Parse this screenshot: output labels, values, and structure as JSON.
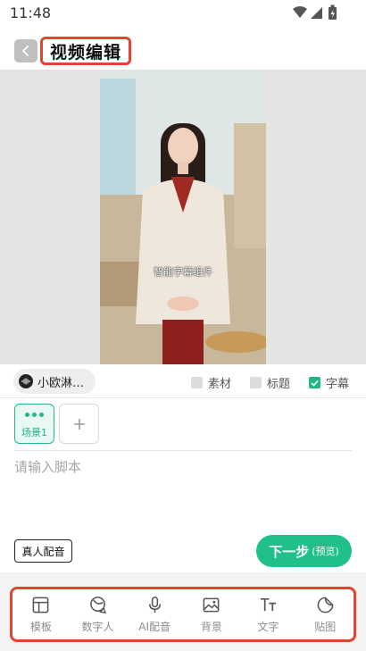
{
  "status_bar": {
    "time": "11:48"
  },
  "header": {
    "title": "视频编辑"
  },
  "preview": {
    "subtitle": "智能字幕组件"
  },
  "options": {
    "voice_name": "小欧淋…",
    "material_label": "素材",
    "material_checked": false,
    "title_label": "标题",
    "title_checked": false,
    "caption_label": "字幕",
    "caption_checked": true
  },
  "scenes": [
    {
      "label": "场景1",
      "selected": true
    }
  ],
  "script": {
    "placeholder": "请输入脚本"
  },
  "buttons": {
    "real_voice": "真人配音",
    "next": "下一步",
    "next_sub": "(预览)"
  },
  "toolbar": [
    {
      "label": "模板",
      "icon": "template-icon"
    },
    {
      "label": "数字人",
      "icon": "digital-human-icon"
    },
    {
      "label": "AI配音",
      "icon": "microphone-icon"
    },
    {
      "label": "背景",
      "icon": "image-icon"
    },
    {
      "label": "文字",
      "icon": "text-icon"
    },
    {
      "label": "贴图",
      "icon": "sticker-icon"
    }
  ],
  "colors": {
    "accent": "#20c08d",
    "highlight": "#e2442f"
  }
}
